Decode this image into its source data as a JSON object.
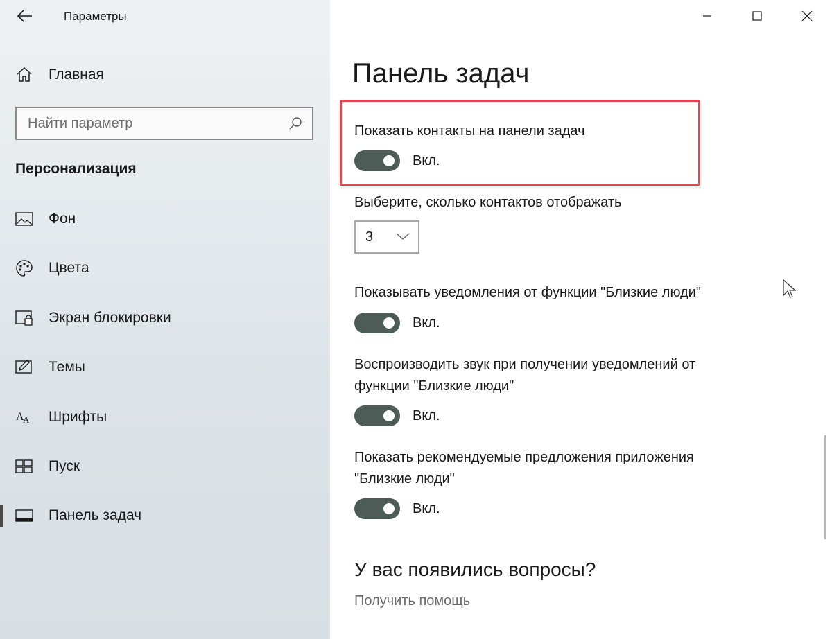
{
  "window": {
    "title": "Параметры",
    "controls": [
      "minimize",
      "maximize",
      "close"
    ]
  },
  "sidebar": {
    "home_label": "Главная",
    "search": {
      "placeholder": "Найти параметр",
      "value": ""
    },
    "section_title": "Персонализация",
    "items": [
      {
        "label": "Фон",
        "icon": "picture-icon"
      },
      {
        "label": "Цвета",
        "icon": "palette-icon"
      },
      {
        "label": "Экран блокировки",
        "icon": "lock-screen-icon"
      },
      {
        "label": "Темы",
        "icon": "themes-icon"
      },
      {
        "label": "Шрифты",
        "icon": "fonts-icon"
      },
      {
        "label": "Пуск",
        "icon": "start-icon"
      },
      {
        "label": "Панель задач",
        "icon": "taskbar-icon",
        "active": true
      }
    ]
  },
  "main": {
    "page_title": "Панель задач",
    "settings": {
      "show_contacts": {
        "label": "Показать контакты на панели задач",
        "state": "Вкл.",
        "on": true
      },
      "contacts_count": {
        "label": "Выберите, сколько контактов отображать",
        "value": "3"
      },
      "show_notifications": {
        "label": "Показывать уведомления от функции \"Близкие люди\"",
        "state": "Вкл.",
        "on": true
      },
      "play_sound": {
        "label_line1": "Воспроизводить звук при получении уведомлений от",
        "label_line2": "функции \"Близкие люди\"",
        "state": "Вкл.",
        "on": true
      },
      "suggestions": {
        "label_line1": "Показать рекомендуемые предложения приложения",
        "label_line2": "\"Близкие люди\"",
        "state": "Вкл.",
        "on": true
      }
    },
    "questions": {
      "heading": "У вас появились вопросы?",
      "help_link": "Получить помощь"
    }
  },
  "colors": {
    "toggle_on": "#4d5c57",
    "highlight": "#e0484d",
    "link": "#6b6b6b"
  }
}
